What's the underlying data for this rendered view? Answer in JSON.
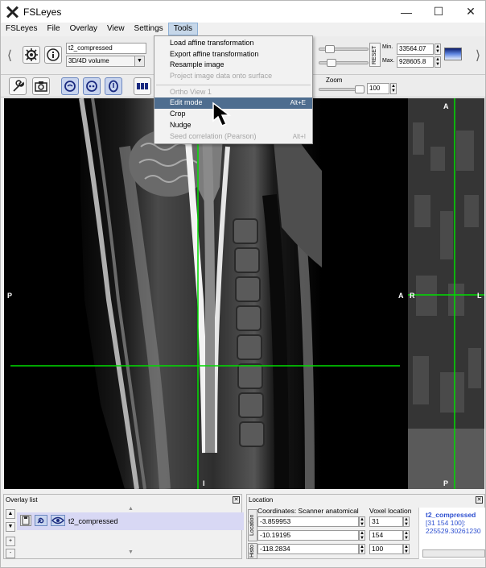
{
  "window": {
    "title": "FSLeyes"
  },
  "menubar": {
    "items": [
      "FSLeyes",
      "File",
      "Overlay",
      "View",
      "Settings",
      "Tools"
    ],
    "active": "Tools"
  },
  "tools_menu": {
    "items": [
      {
        "label": "Load affine transformation",
        "enabled": true
      },
      {
        "label": "Export affine transformation",
        "enabled": true
      },
      {
        "label": "Resample image",
        "enabled": true
      },
      {
        "label": "Project image data onto surface",
        "enabled": false
      },
      {
        "label": "Ortho View 1",
        "enabled": false,
        "separator_before": true
      },
      {
        "label": "Edit mode",
        "enabled": true,
        "highlight": true,
        "shortcut": "Alt+E"
      },
      {
        "label": "Crop",
        "enabled": true
      },
      {
        "label": "Nudge",
        "enabled": true
      },
      {
        "label": "Seed correlation (Pearson)",
        "enabled": false,
        "shortcut": "Alt+I"
      }
    ]
  },
  "overlay_toolbar": {
    "overlay_name": "t2_compressed",
    "overlay_type": "3D/4D volume",
    "min_label": "Min.",
    "max_label": "Max.",
    "min_value": "33564.07",
    "max_value": "928605.8",
    "reset_label": "RESET"
  },
  "ortho_toolbar": {
    "zoom_label": "Zoom",
    "zoom_value": "100"
  },
  "viewer": {
    "sagittal_labels": {
      "top": "",
      "left": "P",
      "right": "A",
      "bottom": "I"
    },
    "coronal_labels": {
      "top": "A",
      "left": "R",
      "right": "L",
      "bottom": "P"
    },
    "cursor_color": "#00dd00"
  },
  "overlay_list": {
    "title": "Overlay list",
    "items": [
      "t2_compressed"
    ]
  },
  "location": {
    "title": "Location",
    "coord_label": "Coordinates: Scanner anatomical",
    "voxel_label": "Voxel location",
    "coords": [
      "-3.859953",
      "-10.19195",
      "-118.2834"
    ],
    "voxels": [
      "31",
      "154",
      "100"
    ],
    "info_name": "t2_compressed",
    "info_voxel": "[31 154 100]:",
    "info_value": "225529.30261230",
    "tab_location": "Location",
    "tab_history": "Histo"
  }
}
